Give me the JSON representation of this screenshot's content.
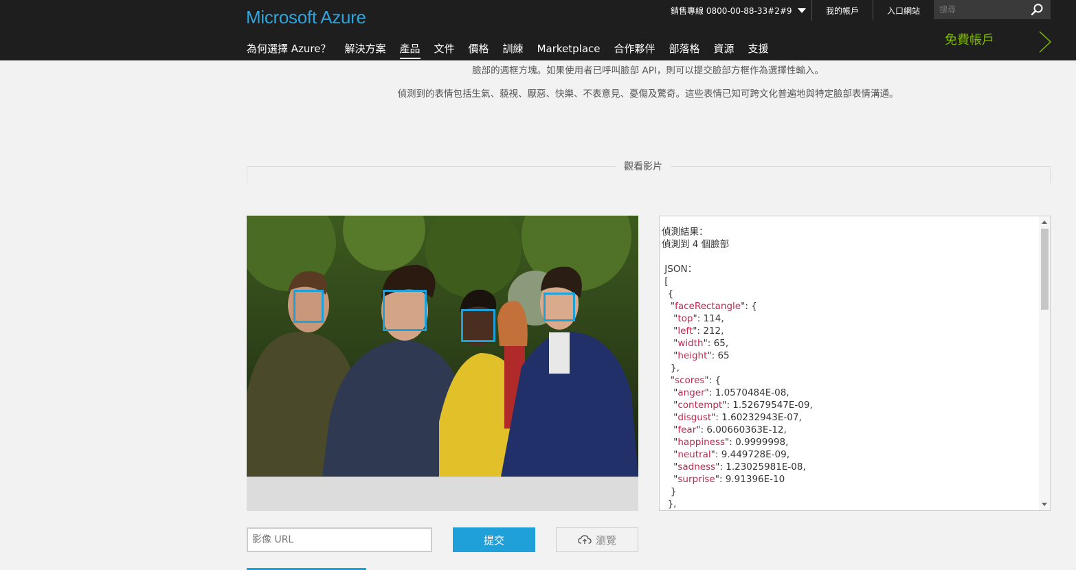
{
  "header": {
    "logo": "Microsoft Azure",
    "sales_line": "銷售專線 0800-00-88-33#2#9",
    "my_account": "我的帳戶",
    "portal": "入口網站",
    "search_placeholder": "搜尋",
    "free_account": "免費帳戶",
    "nav": [
      "為何選擇 Azure？",
      "解決方案",
      "產品",
      "文件",
      "價格",
      "訓練",
      "Marketplace",
      "合作夥伴",
      "部落格",
      "資源",
      "支援"
    ],
    "active_nav": "產品"
  },
  "content": {
    "para1": "臉部的週框方塊。如果使用者已呼叫臉部 API，則可以提交臉部方框作為選擇性輸入。",
    "para2": "偵測到的表情包括生氣、藐視、厭惡、快樂、不表意見、憂傷及驚奇。這些表情已知可跨文化普遍地與特定臉部表情溝通。",
    "video_label": "觀看影片"
  },
  "result": {
    "heading": "偵測結果：",
    "count_line": "偵測到 4 個臉部",
    "json_label": "JSON：",
    "face": {
      "top": "114",
      "left": "212",
      "width": "65",
      "height": "65"
    },
    "scores": [
      {
        "name": "anger",
        "value": "1.0570484E-08"
      },
      {
        "name": "contempt",
        "value": "1.52679547E-09"
      },
      {
        "name": "disgust",
        "value": "1.60232943E-07"
      },
      {
        "name": "fear",
        "value": "6.00660363E-12"
      },
      {
        "name": "happiness",
        "value": "0.9999998"
      },
      {
        "name": "neutral",
        "value": "9.449728E-09"
      },
      {
        "name": "sadness",
        "value": "1.23025981E-08"
      },
      {
        "name": "surprise",
        "value": "9.91396E-10"
      }
    ]
  },
  "controls": {
    "url_placeholder": "影像 URL",
    "submit_label": "提交",
    "browse_label": "瀏覽"
  },
  "colors": {
    "accent": "#1fa0d8",
    "free_green": "#7fba00",
    "header_bg": "#1e1e1e"
  }
}
